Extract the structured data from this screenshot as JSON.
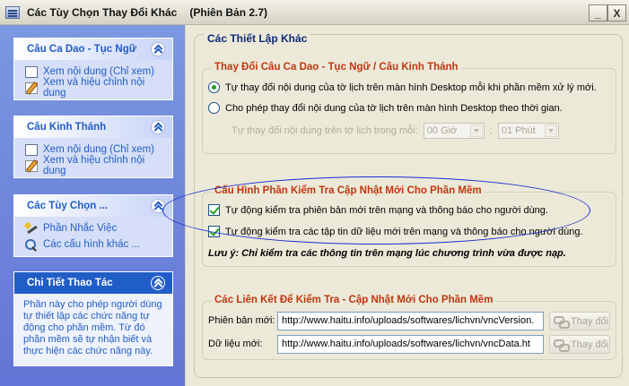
{
  "window": {
    "title": "Các Tùy Chọn Thay Đổi Khác",
    "version": "(Phiên Bản 2.7)",
    "minimize_label": "_",
    "close_label": "X"
  },
  "sidebar": {
    "panels": [
      {
        "title": "Câu Ca Dao - Tục Ngữ",
        "links": [
          {
            "label": "Xem nội dung (Chỉ xem)",
            "icon": "book-icon"
          },
          {
            "label": "Xem và hiệu chỉnh nội dung",
            "icon": "edit-icon"
          }
        ]
      },
      {
        "title": "Câu Kinh Thánh",
        "links": [
          {
            "label": "Xem nội dung (Chỉ xem)",
            "icon": "book-icon"
          },
          {
            "label": "Xem và hiệu chỉnh nội dung",
            "icon": "edit-icon"
          }
        ]
      },
      {
        "title": "Các Tùy Chọn ...",
        "links": [
          {
            "label": "Phần Nhắc Việc",
            "icon": "wand-icon"
          },
          {
            "label": "Các cấu hình khác ...",
            "icon": "search-icon"
          }
        ]
      }
    ],
    "details": {
      "title": "Chi Tiết Thao Tác",
      "text": "Phần này cho phép người dùng tự thiết lập các chức năng tự động cho phần mềm. Từ đó phần mềm sẽ tự nhận biết và thực hiện các chức năng này."
    }
  },
  "main": {
    "title": "Các Thiết Lập Khác",
    "change_group": {
      "title": "Thay Đổi Câu Ca Dao - Tục Ngữ / Câu Kinh Thánh",
      "option_auto": "Tự thay đổi nội dung của tờ lịch trên màn hình Desktop mỗi khi phần mềm xử lý mới.",
      "option_timed": "Cho phép thay đổi nội dung của tờ lịch trên màn hình Desktop theo thời gian.",
      "selected": "auto",
      "interval_label": "Tự thay đổi nội dung trên tờ lịch trong mỗi:",
      "hours_value": "00 Giờ",
      "separator": ":",
      "minutes_value": "01 Phút"
    },
    "update_group": {
      "title": "Cấu Hình Phần Kiểm Tra Cập Nhật Mới Cho Phần Mềm",
      "check_version": "Tự động kiểm tra phiên bản mới trên mạng và thông báo cho người dùng.",
      "check_data": "Tự động kiểm tra các tập tin dữ liệu mới trên mạng và thông báo cho người dùng.",
      "check_version_on": true,
      "check_data_on": true,
      "note": "Lưu ý: Chỉ kiểm tra các thông tin trên mạng lúc chương trình vừa được nạp."
    },
    "links_group": {
      "title": "Các Liên Kết Để Kiểm Tra - Cập Nhật Mới Cho Phần Mềm",
      "version_label": "Phiên bản mới:",
      "version_url": "http://www.haitu.info/uploads/softwares/lichvn/vncVersion.",
      "data_label": "Dữ liệu mới:",
      "data_url": "http://www.haitu.info/uploads/softwares/lichvn/vncData.ht",
      "change_label": "Thay đổi"
    }
  },
  "colors": {
    "sidebar_gradient_top": "#7b98e0",
    "sidebar_gradient_bottom": "#6375d6",
    "panel_title": "#215dc6",
    "group_title": "#c0360f",
    "main_title": "#0f2a7a",
    "annotation_ellipse": "#1a2dd1"
  }
}
